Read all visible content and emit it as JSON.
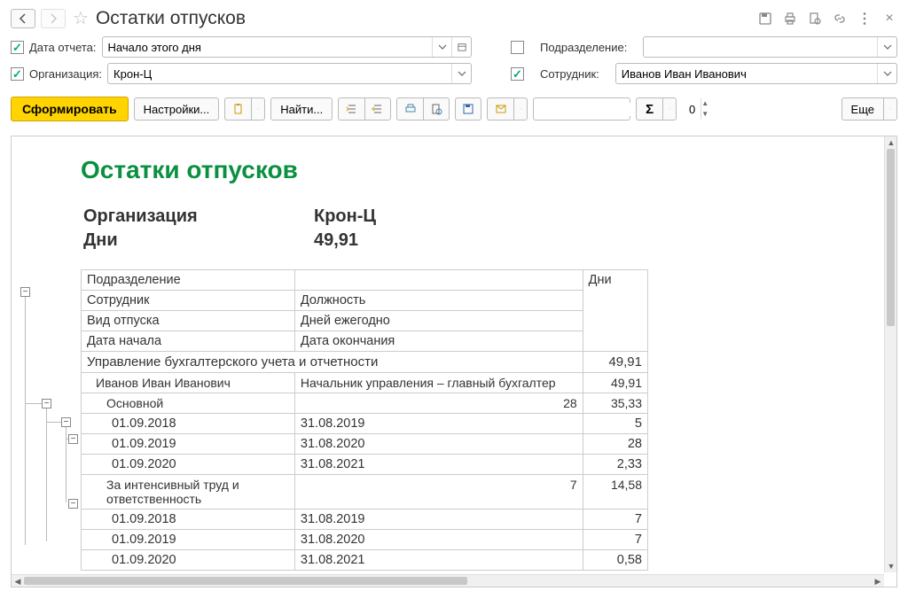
{
  "title": "Остатки отпусков",
  "filters": {
    "date_label": "Дата отчета:",
    "date_value": "Начало этого дня",
    "org_label": "Организация:",
    "org_value": "Крон-Ц",
    "dept_label": "Подразделение:",
    "dept_value": "",
    "emp_label": "Сотрудник:",
    "emp_value": "Иванов Иван Иванович"
  },
  "cmd": {
    "generate": "Сформировать",
    "settings": "Настройки...",
    "find": "Найти...",
    "more": "Еще",
    "num_value": "0"
  },
  "report": {
    "title": "Остатки отпусков",
    "summary_org_label": "Организация",
    "summary_org_value": "Крон-Ц",
    "summary_days_label": "Дни",
    "summary_days_value": "49,91",
    "hdr": {
      "dept": "Подразделение",
      "days": "Дни",
      "emp": "Сотрудник",
      "pos": "Должность",
      "vtype": "Вид отпуска",
      "per_year": "Дней ежегодно",
      "dstart": "Дата начала",
      "dend": "Дата окончания"
    },
    "dept_row": {
      "name": "Управление бухгалтерского учета и отчетности",
      "days": "49,91"
    },
    "emp_row": {
      "name": "Иванов Иван Иванович",
      "pos": "Начальник управления – главный бухгалтер",
      "days": "49,91"
    },
    "vac1": {
      "name": "Основной",
      "per_year": "28",
      "days": "35,33",
      "periods": [
        {
          "start": "01.09.2018",
          "end": "31.08.2019",
          "days": "5"
        },
        {
          "start": "01.09.2019",
          "end": "31.08.2020",
          "days": "28"
        },
        {
          "start": "01.09.2020",
          "end": "31.08.2021",
          "days": "2,33"
        }
      ]
    },
    "vac2": {
      "name": "За интенсивный труд и ответственность",
      "per_year": "7",
      "days": "14,58",
      "periods": [
        {
          "start": "01.09.2018",
          "end": "31.08.2019",
          "days": "7"
        },
        {
          "start": "01.09.2019",
          "end": "31.08.2020",
          "days": "7"
        },
        {
          "start": "01.09.2020",
          "end": "31.08.2021",
          "days": "0,58"
        }
      ]
    }
  }
}
